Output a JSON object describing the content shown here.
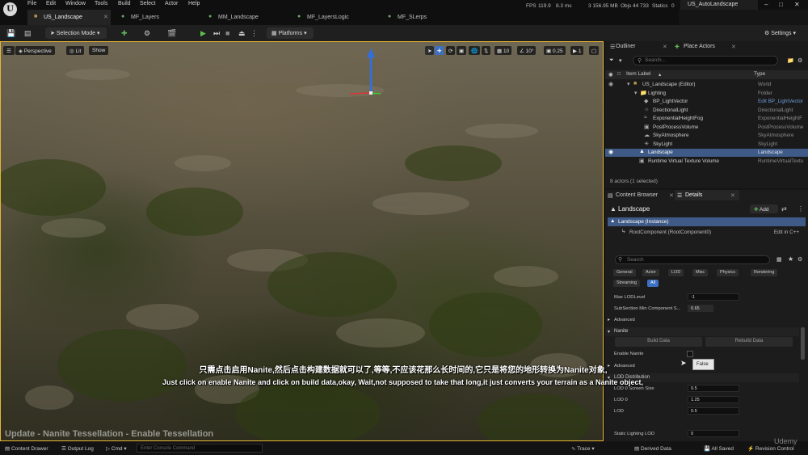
{
  "menu": [
    "File",
    "Edit",
    "Window",
    "Tools",
    "Build",
    "Select",
    "Actor",
    "Help"
  ],
  "stats": {
    "fps_label": "FPS",
    "fps": "119.9",
    "ms": "8.3 ms",
    "mem": "3 156.95 MB",
    "objs_label": "Objs",
    "objs": "44 733",
    "statics_label": "Statics",
    "statics": "0"
  },
  "project_tab": "US_AutoLandscape",
  "doc_tabs": [
    {
      "label": "US_Landscape",
      "active": true
    },
    {
      "label": "MF_Layers",
      "active": false
    },
    {
      "label": "MM_Landscape",
      "active": false
    },
    {
      "label": "MF_LayersLogic",
      "active": false
    },
    {
      "label": "MF_SLerps",
      "active": false
    }
  ],
  "toolbar": {
    "selection_mode": "Selection Mode",
    "platforms": "Platforms",
    "settings": "Settings"
  },
  "viewport": {
    "perspective": "Perspective",
    "lit": "Lit",
    "show": "Show",
    "grid_snap": "10",
    "rot_snap": "10°",
    "scale_snap": "0.25",
    "cam_speed": "1",
    "overlay_title": "Update - Nanite Tessellation - Enable Tessellation"
  },
  "subtitles": {
    "zh": "只需点击启用Nanite,然后点击构建数据就可以了,等等,不应该花那么长时间的,它只是将您的地形转换为Nanite对象,",
    "en": "Just click on enable Nanite and click on build data,okay, Wait,not supposed to take that long,it just converts your terrain as a Nanite object,"
  },
  "outliner": {
    "tab": "Outliner",
    "tab2": "Place Actors",
    "search_placeholder": "Search...",
    "col_label": "Item Label",
    "col_type": "Type",
    "rows": [
      {
        "label": "US_Landscape (Editor)",
        "type": "World",
        "indent": 0
      },
      {
        "label": "Lighting",
        "type": "Folder",
        "indent": 1
      },
      {
        "label": "BP_LightVector",
        "type": "Edit BP_LightVector",
        "indent": 2
      },
      {
        "label": "DirectionalLight",
        "type": "DirectionalLight",
        "indent": 2
      },
      {
        "label": "ExponentialHeightFog",
        "type": "ExponentialHeightF",
        "indent": 2
      },
      {
        "label": "PostProcessVolume",
        "type": "PostProcessVolume",
        "indent": 2
      },
      {
        "label": "SkyAtmosphere",
        "type": "SkyAtmosphere",
        "indent": 2
      },
      {
        "label": "SkyLight",
        "type": "SkyLight",
        "indent": 2
      },
      {
        "label": "Landscape",
        "type": "Landscape",
        "indent": 1,
        "selected": true
      },
      {
        "label": "Runtime Virtual Texture Volume",
        "type": "RuntimeVirtualTextu",
        "indent": 1
      }
    ],
    "footer": "8 actors (1 selected)"
  },
  "details": {
    "tab_content_browser": "Content Browser",
    "tab_details": "Details",
    "title": "Landscape",
    "add_label": "Add",
    "instance": "Landscape (Instance)",
    "root_component": "RootComponent (RootComponent0)",
    "edit_cpp": "Edit in C++",
    "search_placeholder": "Search",
    "filters_row1": [
      "General",
      "Actor",
      "LOD",
      "Misc",
      "Physics",
      "Rendering"
    ],
    "filters_row2": [
      "Streaming",
      "All"
    ],
    "max_lod_label": "Max LODLevel",
    "max_lod_value": "-1",
    "subsection_label": "SubSection Min Component S...",
    "subsection_value": "0.65",
    "advanced": "Advanced",
    "nanite_section": "Nanite",
    "build_data": "Build Data",
    "rebuild_data": "Rebuild Data",
    "enable_nanite": "Enable Nanite",
    "tooltip": "False",
    "advanced2": "Advanced",
    "lod_distribution": "LOD Distribution",
    "lod0_screen_label": "LOD 0 Screen Size",
    "lod0_screen_value": "0.5",
    "lod0_label": "LOD 0",
    "lod0_value": "1.25",
    "lod_label": "LOD",
    "lod_value": "0.5",
    "static_lighting_label": "Static Lighting LOD",
    "static_lighting_value": "0"
  },
  "statusbar": {
    "content_drawer": "Content Drawer",
    "output_log": "Output Log",
    "cmd": "Cmd",
    "console_placeholder": "Enter Console Command",
    "trace": "Trace",
    "derived_data": "Derived Data",
    "all_saved": "All Saved",
    "revision_control": "Revision Control"
  },
  "watermark": "Udemy",
  "colors": {
    "selection": "#3f5a86",
    "accent_yellow": "#e7b530",
    "play_green": "#5fc04a",
    "filter_on": "#3c70c3"
  }
}
